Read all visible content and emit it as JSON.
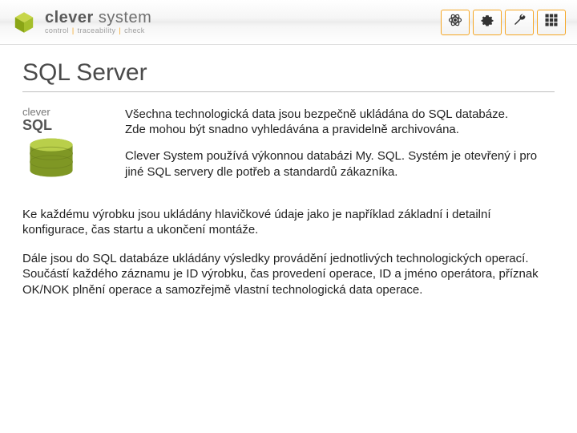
{
  "header": {
    "brand_main": "clever",
    "brand_secondary": "system",
    "tagline_parts": [
      "control",
      "traceability",
      "check"
    ]
  },
  "toolbar": {
    "items": [
      {
        "name": "atom-icon"
      },
      {
        "name": "gear-icon"
      },
      {
        "name": "wrench-icon"
      },
      {
        "name": "grid-icon"
      }
    ]
  },
  "page": {
    "title": "SQL Server",
    "logo_top": "clever",
    "logo_big": "SQL",
    "intro1": "Všechna technologická data jsou bezpečně ukládána do SQL databáze.\nZde mohou být snadno vyhledávána a pravidelně archivována.",
    "intro2": "Clever System používá výkonnou databázi My. SQL. Systém je otevřený i pro jiné SQL servery dle potřeb a standardů zákazníka.",
    "body1": "Ke každému výrobku jsou ukládány hlavičkové údaje jako je například základní i detailní konfigurace, čas startu a ukončení montáže.",
    "body2": "Dále jsou do SQL databáze ukládány výsledky provádění jednotlivých technologických operací. Součástí každého záznamu je ID výrobku, čas provedení operace, ID a jméno operátora, příznak OK/NOK plnění operace a samozřejmě vlastní technologická data operace."
  }
}
